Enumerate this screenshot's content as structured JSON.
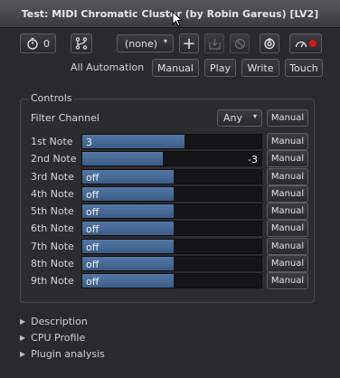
{
  "window": {
    "title": "Test: MIDI Chromatic Cluster (by Robin Gareus) [LV2]"
  },
  "toolbar": {
    "latency_value": "0",
    "preset_select": "(none)",
    "all_automation_label": "All Automation",
    "automation_buttons": [
      "Manual",
      "Play",
      "Write",
      "Touch"
    ]
  },
  "controls": {
    "group_label": "Controls",
    "filter_channel": {
      "label": "Filter Channel",
      "value": "Any",
      "mode": "Manual"
    },
    "notes": [
      {
        "label": "1st Note",
        "value": "3",
        "align": "left",
        "fill": 0.57,
        "mode": "Manual"
      },
      {
        "label": "2nd Note",
        "value": "-3",
        "align": "right",
        "fill": 0.45,
        "mode": "Manual"
      },
      {
        "label": "3rd Note",
        "value": "off",
        "align": "left",
        "fill": 0.51,
        "mode": "Manual"
      },
      {
        "label": "4th Note",
        "value": "off",
        "align": "left",
        "fill": 0.51,
        "mode": "Manual"
      },
      {
        "label": "5th Note",
        "value": "off",
        "align": "left",
        "fill": 0.51,
        "mode": "Manual"
      },
      {
        "label": "6th Note",
        "value": "off",
        "align": "left",
        "fill": 0.51,
        "mode": "Manual"
      },
      {
        "label": "7th Note",
        "value": "off",
        "align": "left",
        "fill": 0.51,
        "mode": "Manual"
      },
      {
        "label": "8th Note",
        "value": "off",
        "align": "left",
        "fill": 0.51,
        "mode": "Manual"
      },
      {
        "label": "9th Note",
        "value": "off",
        "align": "left",
        "fill": 0.51,
        "mode": "Manual"
      }
    ]
  },
  "sections": [
    "Description",
    "CPU Profile",
    "Plugin analysis"
  ],
  "colors": {
    "accent": "#4a6d9a",
    "record": "#d11a1a"
  }
}
